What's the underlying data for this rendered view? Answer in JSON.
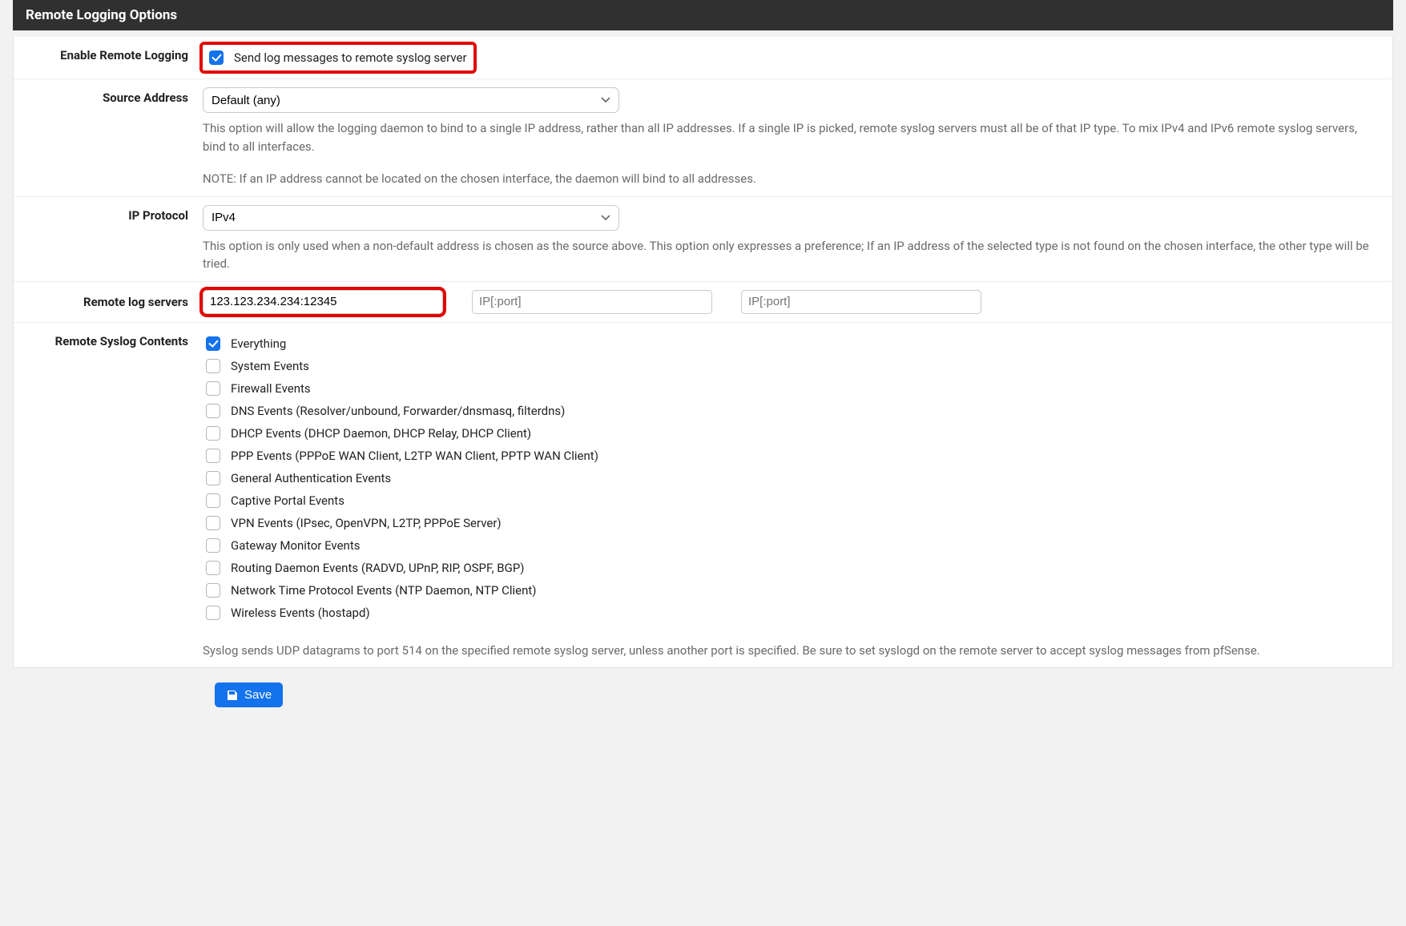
{
  "panel": {
    "title": "Remote Logging Options"
  },
  "enable": {
    "label": "Enable Remote Logging",
    "checkbox_label": "Send log messages to remote syslog server",
    "checked": true
  },
  "source_address": {
    "label": "Source Address",
    "selected": "Default (any)",
    "help1": "This option will allow the logging daemon to bind to a single IP address, rather than all IP addresses. If a single IP is picked, remote syslog servers must all be of that IP type. To mix IPv4 and IPv6 remote syslog servers, bind to all interfaces.",
    "help2": "NOTE: If an IP address cannot be located on the chosen interface, the daemon will bind to all addresses."
  },
  "ip_protocol": {
    "label": "IP Protocol",
    "selected": "IPv4",
    "help": "This option is only used when a non-default address is chosen as the source above. This option only expresses a preference; If an IP address of the selected type is not found on the chosen interface, the other type will be tried."
  },
  "servers": {
    "label": "Remote log servers",
    "value1": "123.123.234.234:12345",
    "placeholder2": "IP[:port]",
    "placeholder3": "IP[:port]"
  },
  "contents": {
    "label": "Remote Syslog Contents",
    "items": [
      {
        "label": "Everything",
        "checked": true
      },
      {
        "label": "System Events",
        "checked": false
      },
      {
        "label": "Firewall Events",
        "checked": false
      },
      {
        "label": "DNS Events (Resolver/unbound, Forwarder/dnsmasq, filterdns)",
        "checked": false
      },
      {
        "label": "DHCP Events (DHCP Daemon, DHCP Relay, DHCP Client)",
        "checked": false
      },
      {
        "label": "PPP Events (PPPoE WAN Client, L2TP WAN Client, PPTP WAN Client)",
        "checked": false
      },
      {
        "label": "General Authentication Events",
        "checked": false
      },
      {
        "label": "Captive Portal Events",
        "checked": false
      },
      {
        "label": "VPN Events (IPsec, OpenVPN, L2TP, PPPoE Server)",
        "checked": false
      },
      {
        "label": "Gateway Monitor Events",
        "checked": false
      },
      {
        "label": "Routing Daemon Events (RADVD, UPnP, RIP, OSPF, BGP)",
        "checked": false
      },
      {
        "label": "Network Time Protocol Events (NTP Daemon, NTP Client)",
        "checked": false
      },
      {
        "label": "Wireless Events (hostapd)",
        "checked": false
      }
    ],
    "help": "Syslog sends UDP datagrams to port 514 on the specified remote syslog server, unless another port is specified. Be sure to set syslogd on the remote server to accept syslog messages from pfSense."
  },
  "save_button": {
    "label": "Save"
  }
}
